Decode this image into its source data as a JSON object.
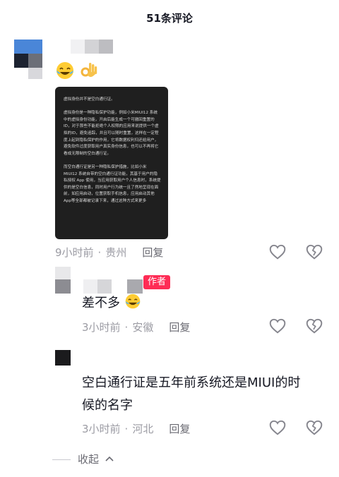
{
  "header": {
    "title": "51条评论"
  },
  "comment1": {
    "image_text": "虚拟身份并不是空白通行证。\n\n虚拟身份是一种隐私保护功能，例如小米MIUI12 系统中的虚拟身份功能，开启后能生成一个可撤回重置的 ID，对于那些不能拒绝个人权限的应用来说提供一个虚拟的ID，避免追踪，并且可以随时重置，这样在一定程度上起到隐私保护的作用，它将数据权利归还给用户，避免软件过度获取用户真实身份信息，也可以不再将它看成无限制的空白通行证。\n\n而空白通行证是另一种隐私保护措施，比如小米 MIUI12 系统自带的空白通行证功能，其基于用户的隐私授权 App 使用，当应用获取用户个人信息时，系统提供的是空白信息，同时用户行为统一且了然地呈现在面前，如应用启动，位置获取手机信息，应用启动其他App等全部都被记录下来，通过这种方式来更多",
    "time": "9小时前",
    "location": "贵州",
    "reply_label": "回复"
  },
  "comment2": {
    "badge": "作者",
    "text": "差不多",
    "time": "3小时前",
    "location": "安徽",
    "reply_label": "回复"
  },
  "comment3": {
    "text_line1": "空白通行证是五年前系统还是MIUI的时",
    "text_line2": "候的名字",
    "time": "3小时前",
    "location": "河北",
    "reply_label": "回复"
  },
  "collapse_label": "收起",
  "colors": {
    "accent": "#fe2c55",
    "meta": "#9b9ba3",
    "avatar_blue": "#4a86d8"
  },
  "icons": [
    "heart-outline-icon",
    "broken-heart-icon",
    "laughing-tears-emoji",
    "ok-hand-emoji",
    "chevron-up-icon"
  ]
}
